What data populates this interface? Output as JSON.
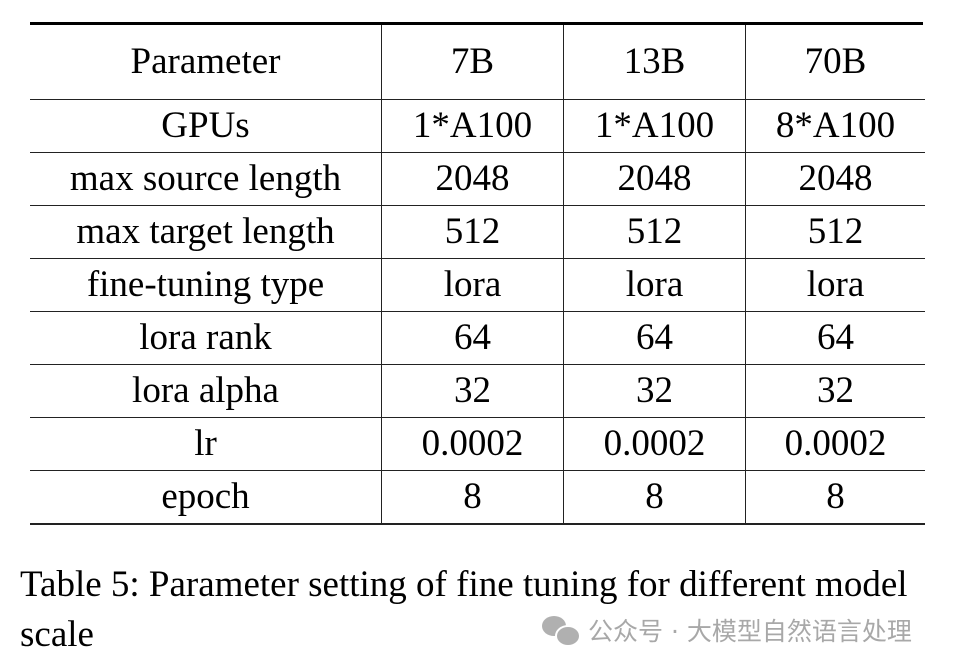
{
  "table": {
    "header": [
      "Parameter",
      "7B",
      "13B",
      "70B"
    ],
    "rows": [
      [
        "GPUs",
        "1*A100",
        "1*A100",
        "8*A100"
      ],
      [
        "max source length",
        "2048",
        "2048",
        "2048"
      ],
      [
        "max target length",
        "512",
        "512",
        "512"
      ],
      [
        "fine-tuning type",
        "lora",
        "lora",
        "lora"
      ],
      [
        "lora rank",
        "64",
        "64",
        "64"
      ],
      [
        "lora alpha",
        "32",
        "32",
        "32"
      ],
      [
        "lr",
        "0.0002",
        "0.0002",
        "0.0002"
      ],
      [
        "epoch",
        "8",
        "8",
        "8"
      ]
    ]
  },
  "caption": "Table 5: Parameter setting of fine tuning for different model scale",
  "watermark": {
    "icon": "wechat-icon",
    "text": "公众号 · 大模型自然语言处理"
  }
}
